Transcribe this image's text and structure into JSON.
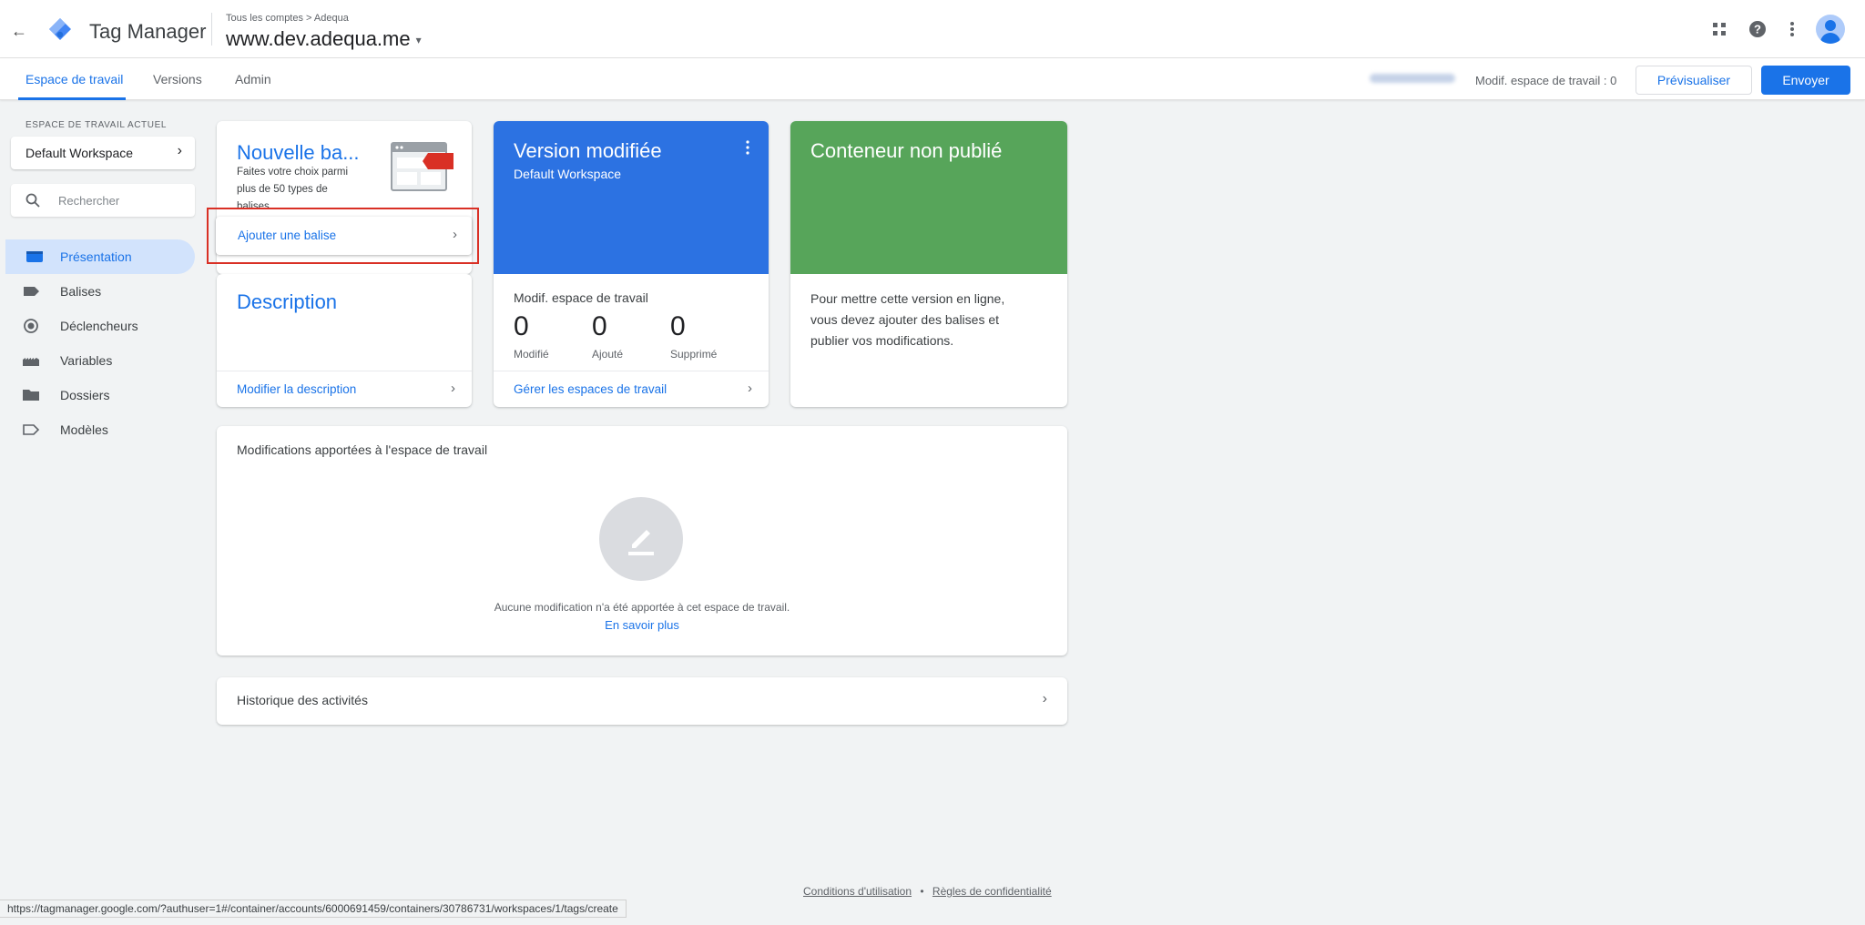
{
  "header": {
    "app_name": "Tag Manager",
    "breadcrumb": "Tous les comptes > Adequa",
    "container_name": "www.dev.adequa.me",
    "back_icon": "arrow-left-icon",
    "icons": [
      "apps-grid-icon",
      "help-icon",
      "more-vert-icon",
      "account-avatar-icon"
    ]
  },
  "subnav": {
    "tabs": [
      {
        "label": "Espace de travail",
        "active": true
      },
      {
        "label": "Versions",
        "active": false
      },
      {
        "label": "Admin",
        "active": false
      }
    ],
    "workspace_changes": "Modif. espace de travail : 0",
    "preview_label": "Prévisualiser",
    "submit_label": "Envoyer"
  },
  "sidebar": {
    "current_workspace_label": "ESPACE DE TRAVAIL ACTUEL",
    "workspace_name": "Default Workspace",
    "search_placeholder": "Rechercher",
    "items": [
      {
        "label": "Présentation",
        "icon": "overview-icon",
        "active": true
      },
      {
        "label": "Balises",
        "icon": "tag-icon",
        "active": false
      },
      {
        "label": "Déclencheurs",
        "icon": "trigger-icon",
        "active": false
      },
      {
        "label": "Variables",
        "icon": "variables-icon",
        "active": false
      },
      {
        "label": "Dossiers",
        "icon": "folder-icon",
        "active": false
      },
      {
        "label": "Modèles",
        "icon": "template-icon",
        "active": false
      }
    ]
  },
  "cards": {
    "new_tag": {
      "title": "Nouvelle ba...",
      "desc_line1": "Faites votre choix parmi",
      "desc_line2": "plus de 50 types de",
      "desc_line3": "balises",
      "link": "Ajouter une balise"
    },
    "description": {
      "title": "Description",
      "link": "Modifier la description"
    },
    "version": {
      "title": "Version modifiée",
      "subtitle": "Default Workspace",
      "stats_title": "Modif. espace de travail",
      "stats": [
        {
          "value": "0",
          "label": "Modifié"
        },
        {
          "value": "0",
          "label": "Ajouté"
        },
        {
          "value": "0",
          "label": "Supprimé"
        }
      ],
      "link": "Gérer les espaces de travail"
    },
    "container": {
      "title": "Conteneur non publié",
      "text_line1": "Pour mettre cette version en ligne,",
      "text_line2": "vous devez ajouter des balises et",
      "text_line3": "publier vos modifications."
    },
    "changes": {
      "title": "Modifications apportées à l'espace de travail",
      "empty_text": "Aucune modification n'a été apportée à cet espace de travail.",
      "learn_more": "En savoir plus"
    },
    "history": {
      "title": "Historique des activités"
    }
  },
  "footer": {
    "terms": "Conditions d'utilisation",
    "separator": "•",
    "privacy": "Règles de confidentialité"
  },
  "status_url": "https://tagmanager.google.com/?authuser=1#/container/accounts/6000691459/containers/30786731/workspaces/1/tags/create",
  "colors": {
    "accent": "#1a73e8",
    "version_card": "#2c72e2",
    "container_card": "#57a55a",
    "highlight": "#d93025"
  }
}
